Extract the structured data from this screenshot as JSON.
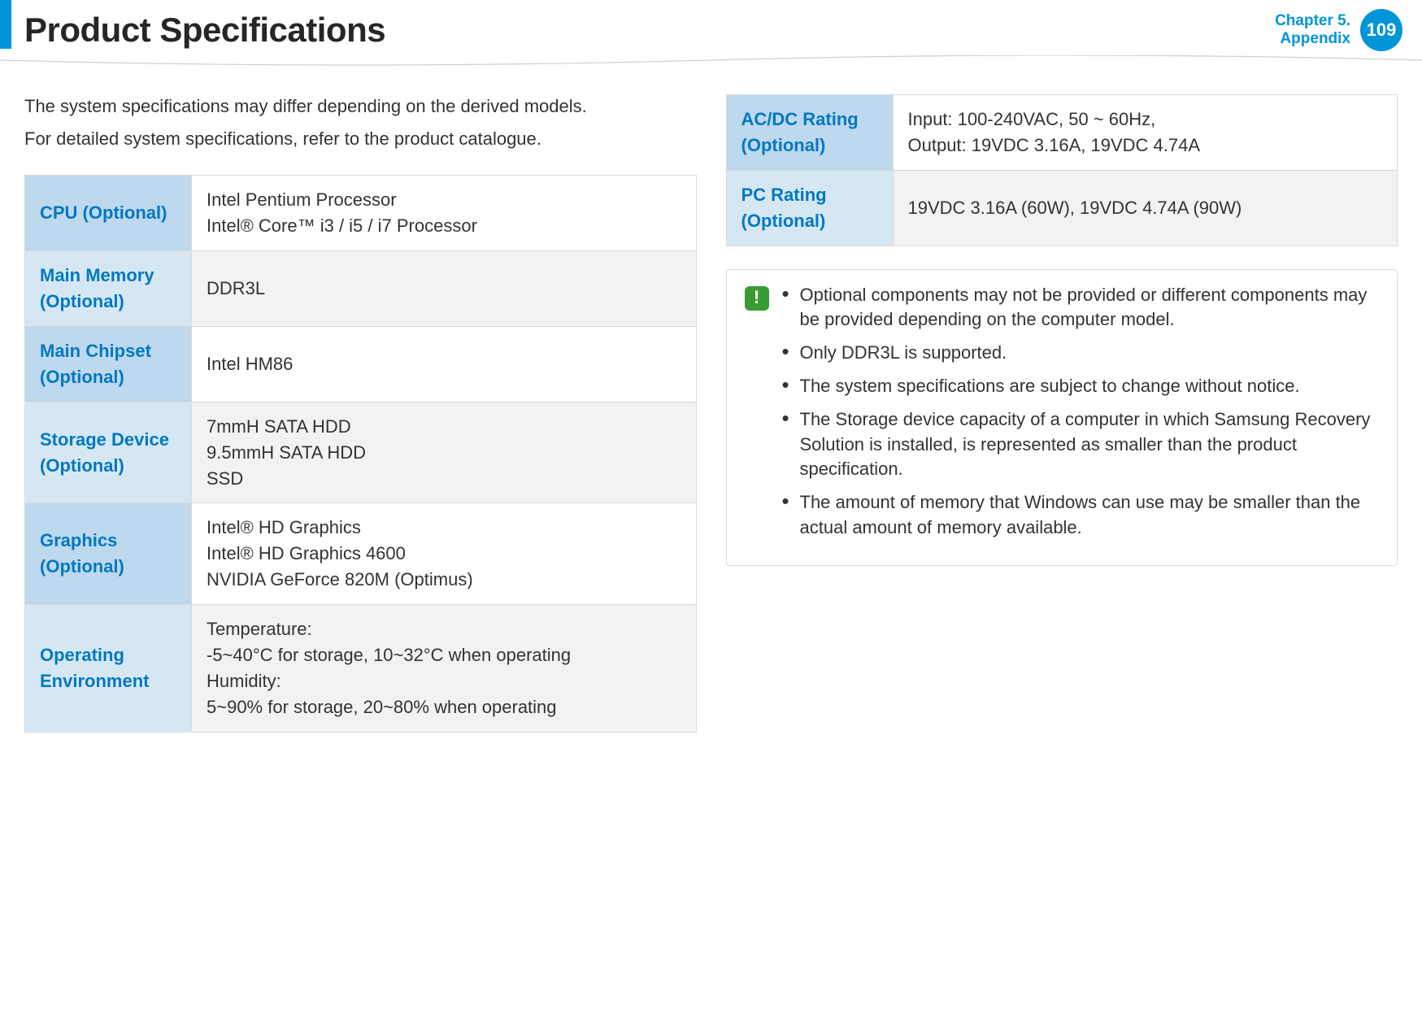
{
  "header": {
    "title": "Product Specifications",
    "chapter_line1": "Chapter 5.",
    "chapter_line2": "Appendix",
    "page": "109"
  },
  "intro": {
    "p1": "The system specifications may differ depending on the derived models.",
    "p2": "For detailed system specifications, refer to the product catalogue."
  },
  "table_left": [
    {
      "label": "CPU (Optional)",
      "value": "Intel Pentium Processor\nIntel® Core™ i3 / i5 / i7 Processor"
    },
    {
      "label": "Main Memory (Optional)",
      "value": "DDR3L"
    },
    {
      "label": "Main Chipset (Optional)",
      "value": "Intel HM86"
    },
    {
      "label": "Storage Device (Optional)",
      "value": "7mmH SATA HDD\n9.5mmH SATA HDD\nSSD"
    },
    {
      "label": "Graphics (Optional)",
      "value": "Intel® HD Graphics\nIntel® HD Graphics 4600\nNVIDIA GeForce 820M (Optimus)"
    },
    {
      "label": "Operating Environment",
      "value": "Temperature:\n-5~40°C for storage, 10~32°C when operating\nHumidity:\n5~90% for storage, 20~80% when operating"
    }
  ],
  "table_right": [
    {
      "label": "AC/DC Rating (Optional)",
      "value": "Input: 100-240VAC, 50 ~ 60Hz,\nOutput: 19VDC 3.16A, 19VDC 4.74A"
    },
    {
      "label": "PC Rating (Optional)",
      "value": "19VDC 3.16A (60W), 19VDC 4.74A (90W)"
    }
  ],
  "notes": [
    "Optional components may not be provided or different components may be provided depending on the computer model.",
    "Only DDR3L is supported.",
    "The system specifications are subject to change without notice.",
    "The Storage device capacity of a computer in which Samsung Recovery Solution is installed, is represented as smaller than the product specification.",
    "The amount of memory that Windows can use may be smaller than the actual amount of memory available."
  ]
}
